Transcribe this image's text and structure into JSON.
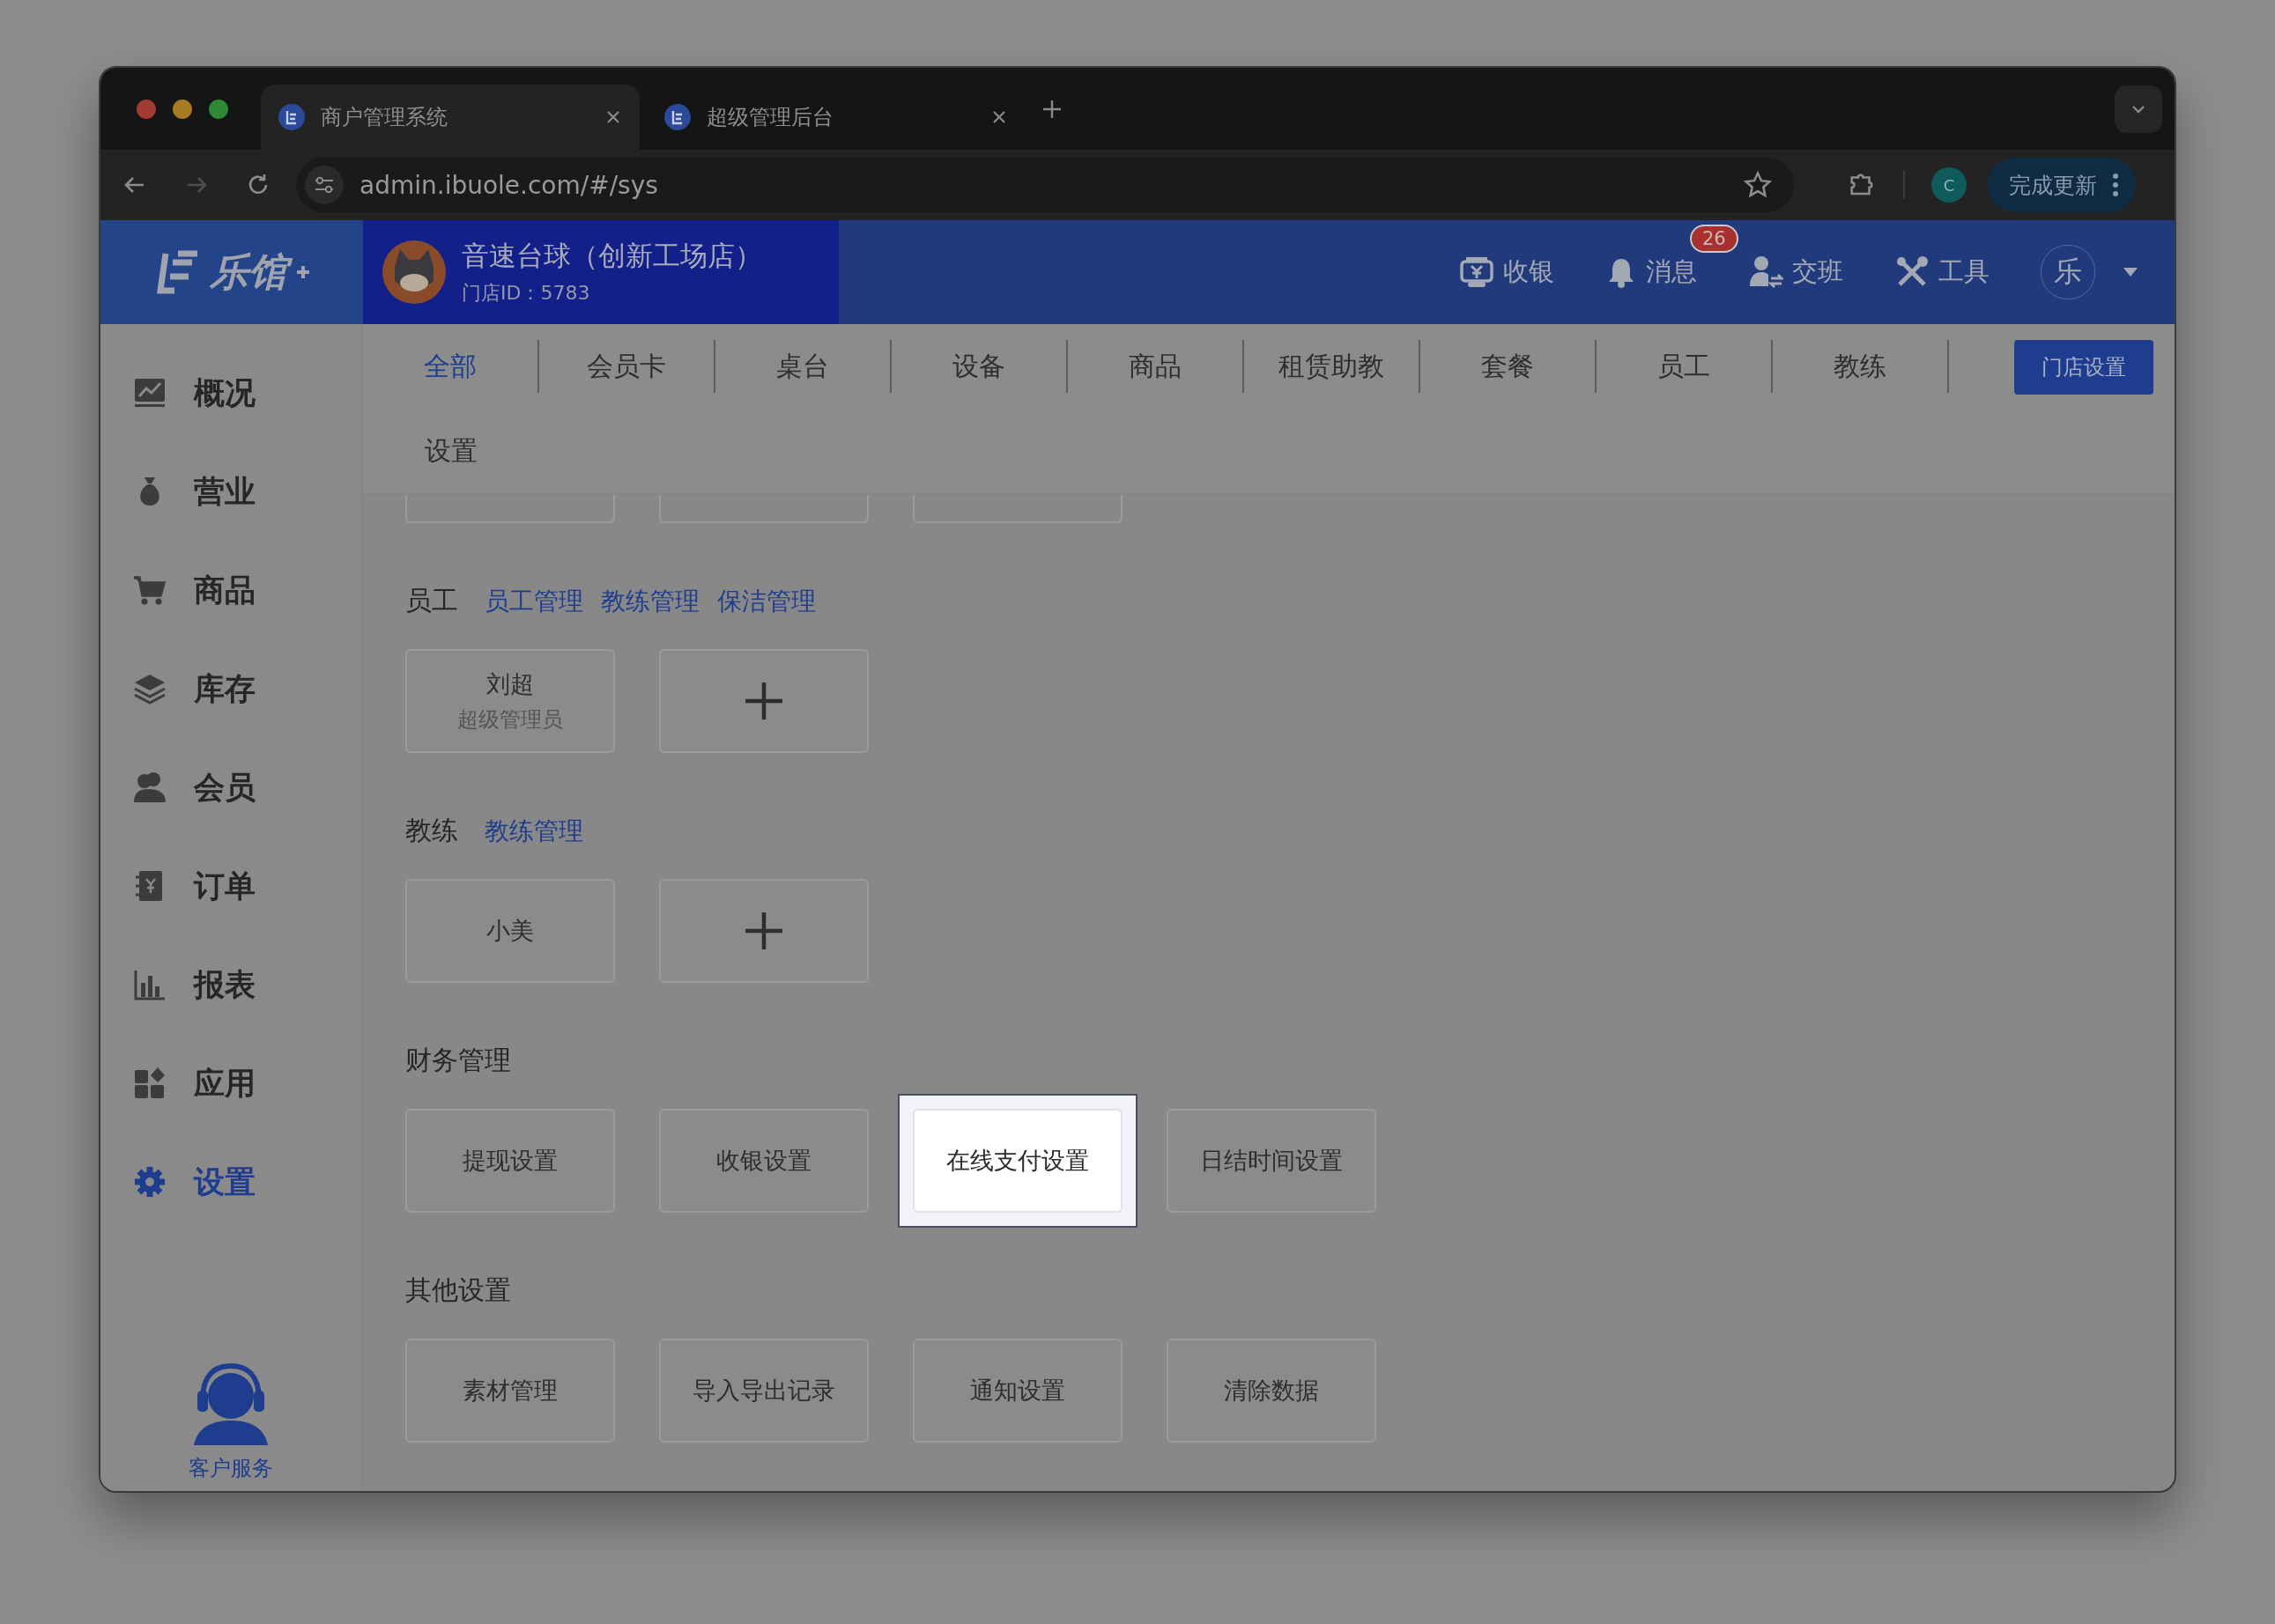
{
  "browser": {
    "tabs": [
      {
        "title": "商户管理系统",
        "selected": true
      },
      {
        "title": "超级管理后台",
        "selected": false
      }
    ],
    "url": "admin.ibuole.com/#/sys",
    "profile": "C",
    "update_button": "完成更新"
  },
  "header": {
    "logo": "乐馆",
    "store_name": "音速台球（创新工场店）",
    "store_id": "门店ID：5783",
    "actions": [
      {
        "label": "收银"
      },
      {
        "label": "消息",
        "badge": "26"
      },
      {
        "label": "交班"
      },
      {
        "label": "工具"
      }
    ],
    "user_avatar": "乐"
  },
  "sidebar": {
    "items": [
      {
        "label": "概况",
        "selected": false
      },
      {
        "label": "营业",
        "selected": false
      },
      {
        "label": "商品",
        "selected": false
      },
      {
        "label": "库存",
        "selected": false
      },
      {
        "label": "会员",
        "selected": false
      },
      {
        "label": "订单",
        "selected": false
      },
      {
        "label": "报表",
        "selected": false
      },
      {
        "label": "应用",
        "selected": false
      },
      {
        "label": "设置",
        "selected": true
      }
    ],
    "support": "客户服务"
  },
  "category_tabs": [
    {
      "label": "全部",
      "selected": true
    },
    {
      "label": "会员卡",
      "selected": false
    },
    {
      "label": "桌台",
      "selected": false
    },
    {
      "label": "设备",
      "selected": false
    },
    {
      "label": "商品",
      "selected": false
    },
    {
      "label": "租赁助教",
      "selected": false
    },
    {
      "label": "套餐",
      "selected": false
    },
    {
      "label": "员工",
      "selected": false
    },
    {
      "label": "教练",
      "selected": false
    },
    {
      "label": "设置",
      "selected": false
    }
  ],
  "store_settings_button": "门店设置",
  "sections": [
    {
      "title": "员工",
      "links": [
        "员工管理",
        "教练管理",
        "保洁管理"
      ],
      "cards": [
        {
          "kind": "person",
          "name": "刘超",
          "role": "超级管理员"
        },
        {
          "kind": "add"
        }
      ]
    },
    {
      "title": "教练",
      "links": [
        "教练管理"
      ],
      "cards": [
        {
          "kind": "person",
          "name": "小美"
        },
        {
          "kind": "add"
        }
      ]
    },
    {
      "title": "财务管理",
      "cards": [
        {
          "kind": "setting",
          "label": "提现设置",
          "highlighted": false
        },
        {
          "kind": "setting",
          "label": "收银设置",
          "highlighted": false
        },
        {
          "kind": "setting",
          "label": "在线支付设置",
          "highlighted": true
        },
        {
          "kind": "setting",
          "label": "日结时间设置",
          "highlighted": false
        }
      ]
    },
    {
      "title": "其他设置",
      "cards": [
        {
          "kind": "setting",
          "label": "素材管理",
          "highlighted": false
        },
        {
          "kind": "setting",
          "label": "导入导出记录",
          "highlighted": false
        },
        {
          "kind": "setting",
          "label": "通知设置",
          "highlighted": false
        },
        {
          "kind": "setting",
          "label": "清除数据",
          "highlighted": false
        }
      ]
    }
  ]
}
